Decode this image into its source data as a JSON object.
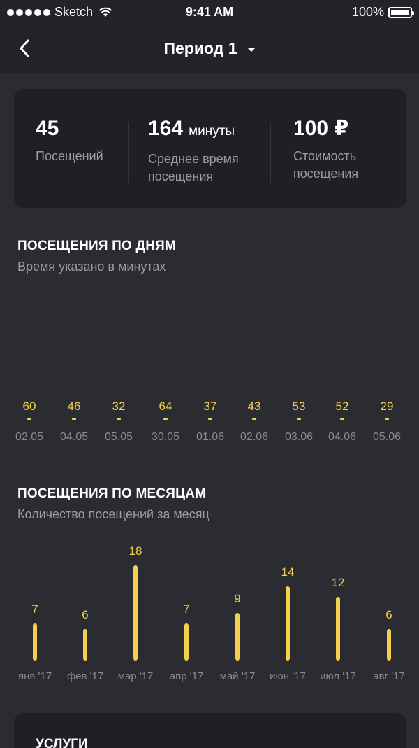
{
  "status_bar": {
    "carrier": "Sketch",
    "time": "9:41 AM",
    "battery": "100%"
  },
  "nav": {
    "title": "Период 1"
  },
  "stats": {
    "visits_value": "45",
    "visits_label": "Посещений",
    "avg_time_value": "164",
    "avg_time_unit": "минуты",
    "avg_time_label_1": "Среднее время",
    "avg_time_label_2": "посещения",
    "cost_value": "100 ₽",
    "cost_label_1": "Стоимость",
    "cost_label_2": "посещения"
  },
  "days_section": {
    "title": "ПОСЕЩЕНИЯ ПО ДНЯМ",
    "subtitle": "Время указано в минутах"
  },
  "months_section": {
    "title": "ПОСЕЩЕНИЯ ПО МЕСЯЦАМ",
    "subtitle": "Количество посещений за месяц"
  },
  "services": {
    "title": "УСЛУГИ"
  },
  "chart_data": [
    {
      "type": "bar",
      "title": "ПОСЕЩЕНИЯ ПО ДНЯМ",
      "subtitle": "Время указано в минутах",
      "categories": [
        "02.05",
        "04.05",
        "05.05",
        "30.05",
        "01.06",
        "02.06",
        "03.06",
        "04.06",
        "05.06"
      ],
      "values": [
        60,
        46,
        32,
        64,
        37,
        43,
        53,
        52,
        29
      ],
      "value_labels": [
        "60",
        "46",
        "32",
        "64",
        "37",
        "43",
        "53",
        "52",
        "29"
      ],
      "color": "#f4d04d"
    },
    {
      "type": "bar",
      "title": "ПОСЕЩЕНИЯ ПО МЕСЯЦАМ",
      "subtitle": "Количество посещений за месяц",
      "categories": [
        "янв '17",
        "фев '17",
        "мар '17",
        "апр '17",
        "май '17",
        "июн '17",
        "июл '17",
        "авг '17"
      ],
      "values": [
        7,
        6,
        18,
        7,
        9,
        14,
        12,
        6
      ],
      "value_labels": [
        "7",
        "6",
        "18",
        "7",
        "9",
        "14",
        "12",
        "6"
      ],
      "ylim": [
        0,
        18
      ],
      "color": "#f4d04d"
    }
  ],
  "colors": {
    "background": "#2a2c31",
    "card": "#1f2024",
    "accent": "#f4d04d",
    "muted_text": "#9b9da3"
  }
}
